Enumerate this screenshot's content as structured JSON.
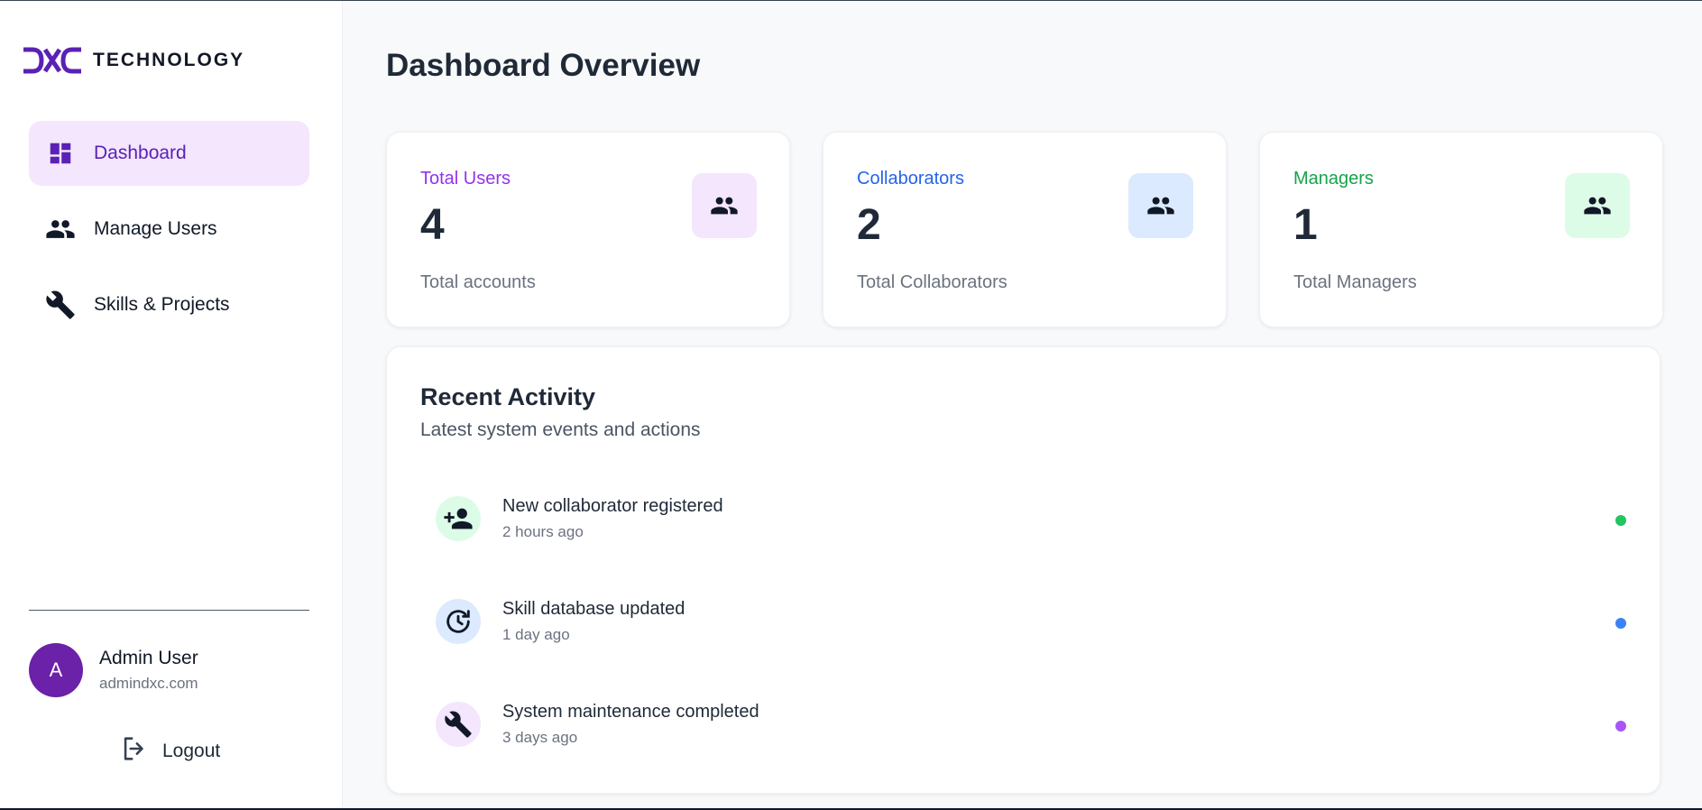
{
  "brand": {
    "logo_mark": "DXC",
    "logo_text": "TECHNOLOGY"
  },
  "sidebar": {
    "items": [
      {
        "label": "Dashboard",
        "icon": "dashboard-icon",
        "active": true
      },
      {
        "label": "Manage Users",
        "icon": "people-icon",
        "active": false
      },
      {
        "label": "Skills & Projects",
        "icon": "wrench-icon",
        "active": false
      }
    ],
    "user": {
      "initial": "A",
      "name": "Admin User",
      "email": "admindxc.com"
    },
    "logout_label": "Logout"
  },
  "main": {
    "title": "Dashboard Overview",
    "stats": [
      {
        "title": "Total Users",
        "value": "4",
        "subtitle": "Total accounts",
        "icon": "people-icon",
        "accent": "#9333ea",
        "icon_bg": "#f3e6fd"
      },
      {
        "title": "Collaborators",
        "value": "2",
        "subtitle": "Total Collaborators",
        "icon": "people-icon",
        "accent": "#2563eb",
        "icon_bg": "#dbeafe"
      },
      {
        "title": "Managers",
        "value": "1",
        "subtitle": "Total Managers",
        "icon": "people-icon",
        "accent": "#16a34a",
        "icon_bg": "#dcfce7"
      }
    ],
    "activity": {
      "title": "Recent Activity",
      "subtitle": "Latest system events and actions",
      "items": [
        {
          "label": "New collaborator registered",
          "time": "2 hours ago",
          "icon": "person-add-icon",
          "icon_bg": "#dcfce7",
          "dot": "#22c55e"
        },
        {
          "label": "Skill database updated",
          "time": "1 day ago",
          "icon": "refresh-clock-icon",
          "icon_bg": "#dbeafe",
          "dot": "#3b82f6"
        },
        {
          "label": "System maintenance completed",
          "time": "3 days ago",
          "icon": "wrench-icon",
          "icon_bg": "#f3e6fd",
          "dot": "#a855f7"
        }
      ]
    }
  }
}
